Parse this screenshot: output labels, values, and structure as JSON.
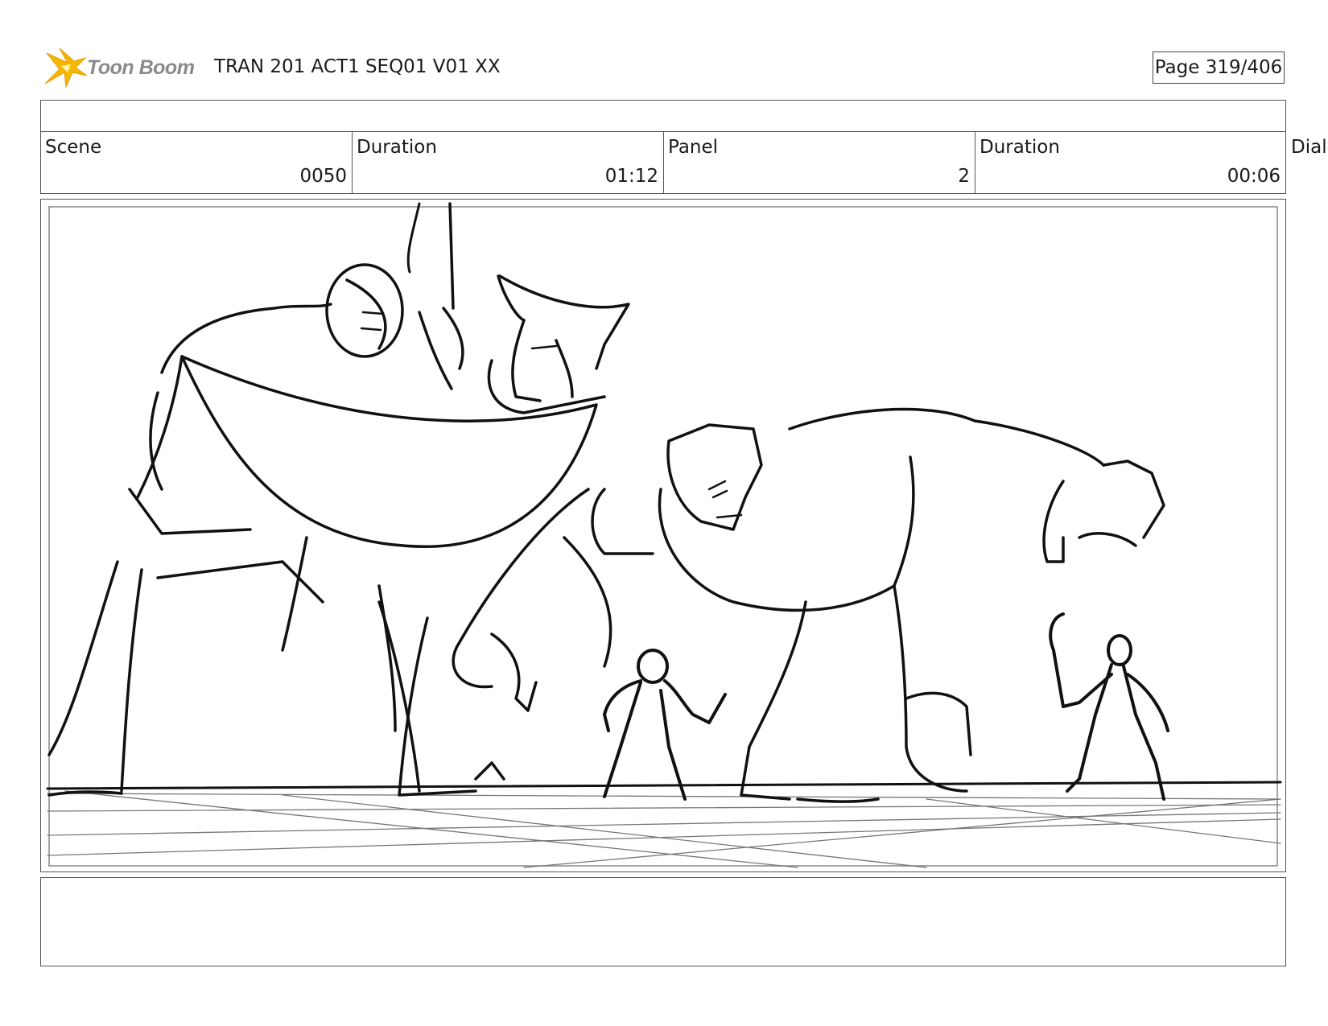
{
  "header": {
    "logo_text": "Toon Boom",
    "title": "TRAN 201 ACT1 SEQ01 V01 XX",
    "page": "Page 319/406"
  },
  "info": {
    "scene_label": "Scene",
    "scene_value": "0050",
    "scene_duration_label": "Duration",
    "scene_duration_value": "01:12",
    "panel_label": "Panel",
    "panel_value": "2",
    "panel_duration_label": "Duration",
    "panel_duration_value": "00:06",
    "dialog_label": "Dialo"
  },
  "icons": {
    "logo": "toon-boom-star-icon"
  },
  "colors": {
    "logo_star": "#f5b800",
    "logo_text": "#8a8a8a",
    "sketch": "#111111"
  }
}
